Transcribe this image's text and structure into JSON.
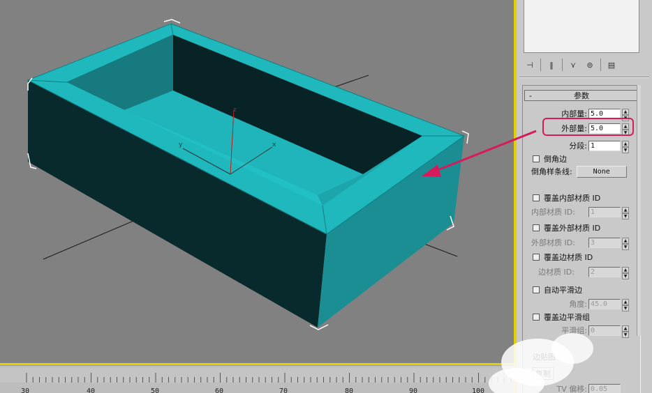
{
  "viewport": {
    "axis_labels": {
      "z": "z",
      "y": "y",
      "x": "x"
    },
    "colors": {
      "background": "#828181",
      "top_face": "#1eb8bd",
      "front_face": "#082a2d",
      "side_face": "#1a8e92",
      "inner_bottom": "#1fb5ba",
      "selection": "#ffffff",
      "active_border": "#e2d000"
    }
  },
  "timeline": {
    "labels": [
      "30",
      "40",
      "50",
      "60",
      "70",
      "80",
      "90",
      "100"
    ]
  },
  "panel": {
    "toolbar_icons": [
      "pin-icon",
      "show-end-result-icon",
      "make-unique-icon",
      "remove-modifier-icon",
      "configure-modifier-sets-icon"
    ],
    "toolbar_glyphs": [
      "⊣",
      "‖",
      "⋎",
      "⊚",
      "▤"
    ],
    "rollout_title": "参数",
    "rollout_minus": "-",
    "inner_amount_label": "内部量:",
    "inner_amount_value": "5.0",
    "outer_amount_label": "外部量:",
    "outer_amount_value": "5.0",
    "segments_label": "分段:",
    "segments_value": "1",
    "bevel_edges_label": "倒角边",
    "bevel_spline_label": "倒角样条线:",
    "bevel_spline_button": "None",
    "override_inner_mat_label": "覆盖内部材质 ID",
    "inner_mat_id_label": "内部材质 ID:",
    "inner_mat_id_value": "1",
    "override_outer_mat_label": "覆盖外部材质 ID",
    "outer_mat_id_label": "外部材质 ID:",
    "outer_mat_id_value": "3",
    "override_edge_mat_label": "覆盖边材质 ID",
    "edge_mat_id_label": "边材质 ID:",
    "edge_mat_id_value": "2",
    "auto_smooth_label": "自动平滑边",
    "angle_label": "角度:",
    "angle_value": "45.0",
    "override_edge_smooth_label": "覆盖边平滑组",
    "smooth_group_label": "平滑组:",
    "smooth_group_value": "0",
    "edge_mapping_label": "边贴图",
    "copy_label": "复制",
    "tv_offset_label": "TV 偏移:",
    "tv_offset_value": "0.05"
  },
  "annotation": {
    "color": "#d61b5c"
  }
}
